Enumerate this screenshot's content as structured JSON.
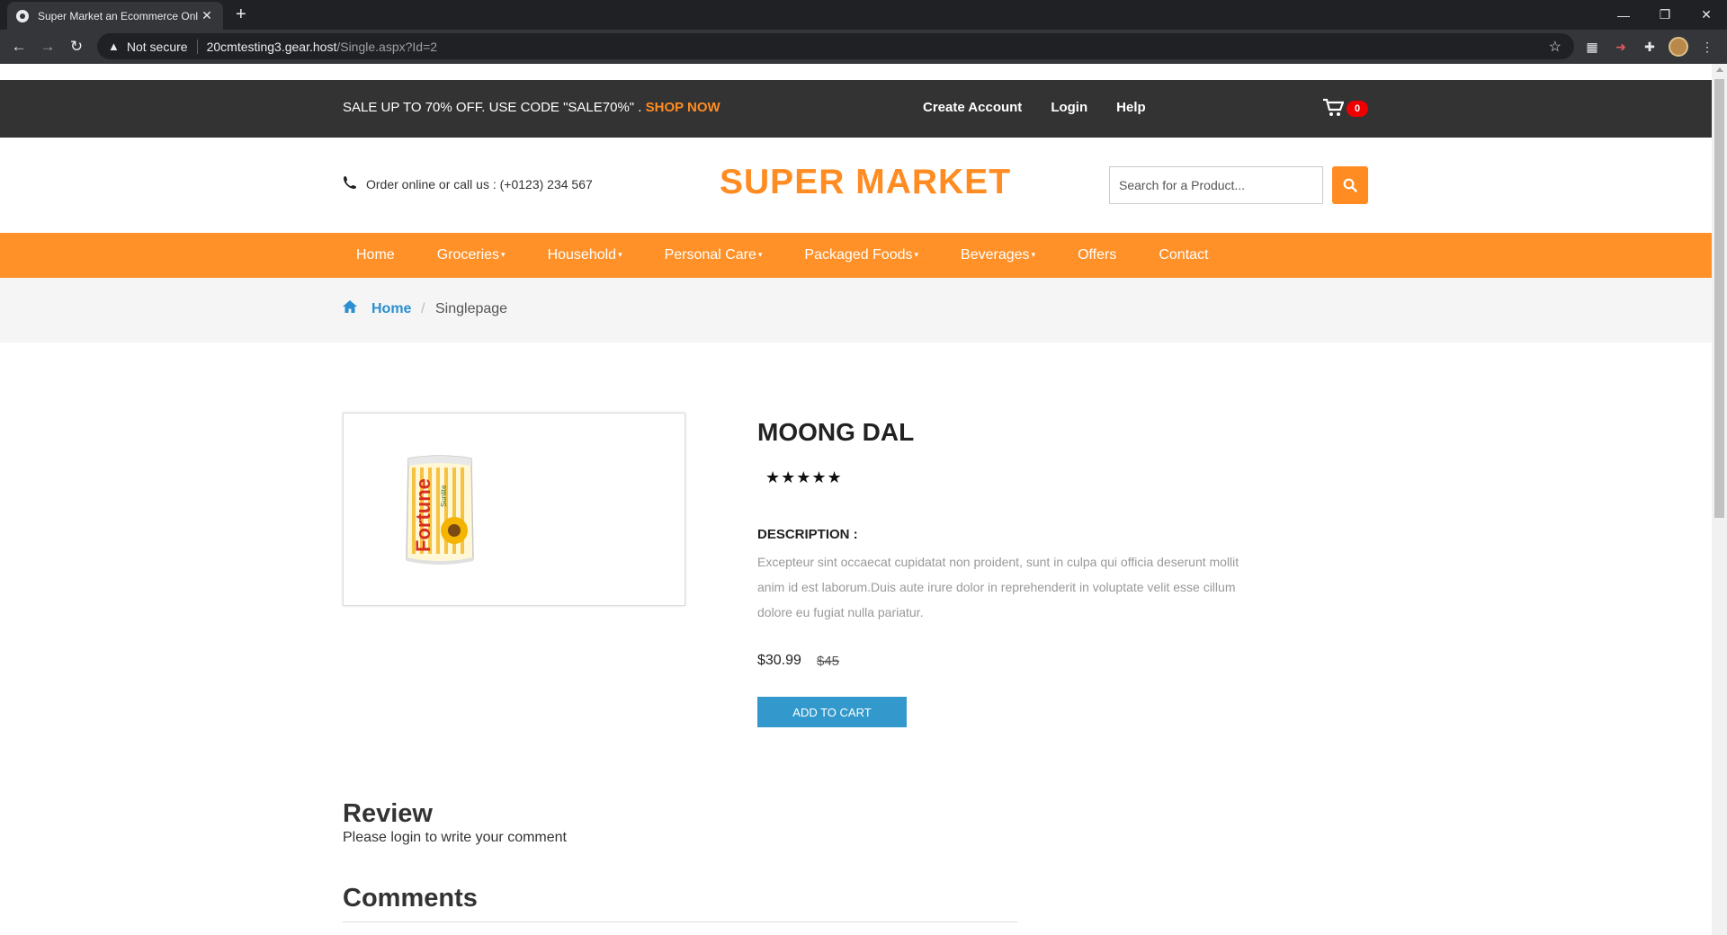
{
  "browser": {
    "tab_title": "Super Market an Ecommerce Onl",
    "security_label": "Not secure",
    "url_host": "20cmtesting3.gear.host",
    "url_path": "/Single.aspx?Id=2"
  },
  "topbar": {
    "promo_text": "SALE UP TO 70% OFF. USE CODE \"SALE70%\" .",
    "shop_now": "SHOP NOW",
    "links": [
      "Create Account",
      "Login",
      "Help"
    ],
    "cart_count": "0"
  },
  "header": {
    "phone_text": "Order online or call us : (+0123) 234 567",
    "logo": "SUPER MARKET",
    "search_placeholder": "Search for a Product..."
  },
  "nav": {
    "items": [
      "Home",
      "Groceries",
      "Household",
      "Personal Care",
      "Packaged Foods",
      "Beverages",
      "Offers",
      "Contact"
    ]
  },
  "breadcrumb": {
    "home": "Home",
    "separator": "/",
    "current": "Singlepage"
  },
  "product": {
    "name": "MOONG DAL",
    "stars": "★★★★★",
    "rating": 5,
    "description_label": "DESCRIPTION :",
    "description": "Excepteur sint occaecat cupidatat non proident, sunt in culpa qui officia deserunt mollit anim id est laborum.Duis aute irure dolor in reprehenderit in voluptate velit esse cillum dolore eu fugiat nulla pariatur.",
    "price": "$30.99",
    "old_price": "$45",
    "add_to_cart": "ADD TO CART",
    "pack_brand": "Fortune",
    "pack_sub": "Sunlite"
  },
  "review": {
    "heading": "Review",
    "message": "Please login to write your comment"
  },
  "comments": {
    "heading": "Comments"
  },
  "colors": {
    "accent": "#ff8c22",
    "nav_bg": "#ff9128",
    "topbar_bg": "#333333",
    "button_blue": "#3399cc",
    "link_blue": "#2b8fd1",
    "badge_red": "#ef0000"
  }
}
